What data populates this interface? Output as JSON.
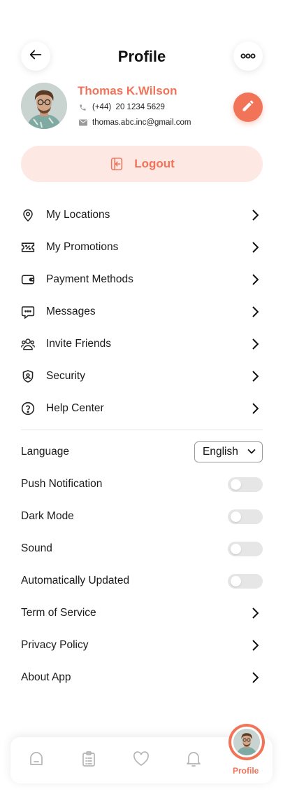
{
  "header": {
    "title": "Profile"
  },
  "user": {
    "name": "Thomas K.Wilson",
    "phone": "(+44)  20 1234 5629",
    "email": "thomas.abc.inc@gmail.com"
  },
  "logout_label": "Logout",
  "menu": [
    {
      "label": "My Locations",
      "icon": "location-pin-icon"
    },
    {
      "label": "My Promotions",
      "icon": "promotion-ticket-icon"
    },
    {
      "label": "Payment Methods",
      "icon": "wallet-icon"
    },
    {
      "label": "Messages",
      "icon": "chat-bubble-icon"
    },
    {
      "label": "Invite Friends",
      "icon": "people-icon"
    },
    {
      "label": "Security",
      "icon": "shield-icon"
    },
    {
      "label": "Help Center",
      "icon": "question-circle-icon"
    }
  ],
  "settings": {
    "language": {
      "label": "Language",
      "value": "English"
    },
    "push_notification": {
      "label": "Push Notification",
      "enabled": false
    },
    "dark_mode": {
      "label": "Dark Mode",
      "enabled": false
    },
    "sound": {
      "label": "Sound",
      "enabled": false
    },
    "auto_update": {
      "label": "Automatically Updated",
      "enabled": false
    }
  },
  "links": [
    {
      "label": "Term of Service"
    },
    {
      "label": "Privacy Policy"
    },
    {
      "label": "About App"
    }
  ],
  "bottom_nav": {
    "items": [
      "home-icon",
      "orders-list-icon",
      "heart-icon",
      "bell-icon"
    ],
    "active_label": "Profile"
  },
  "colors": {
    "accent": "#f0735a",
    "accent_light": "#fde8e3",
    "toggle_off": "#e6e6e6"
  }
}
